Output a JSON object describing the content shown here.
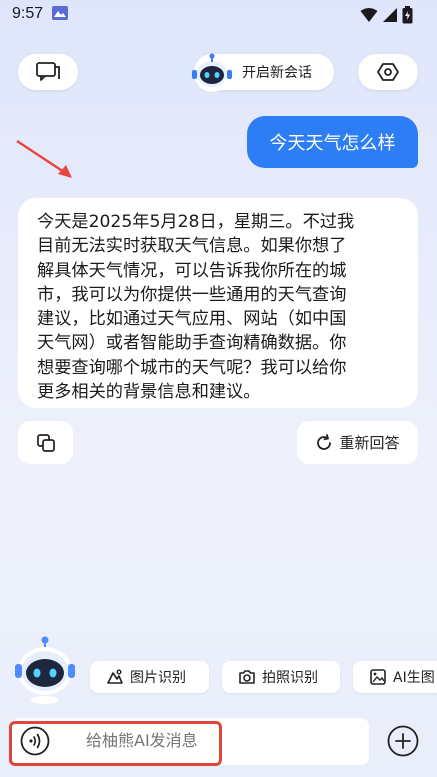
{
  "status_bar": {
    "time": "9:57"
  },
  "header": {
    "new_chat_label": "开启新会话"
  },
  "conversation": {
    "user_message": "今天天气怎么样",
    "ai_lines": [
      "今天是2025年5月28日，星期三。不过我",
      "目前无法实时获取天气信息。如果你想了",
      "解具体天气情况，可以告诉我你所在的城",
      "市，我可以为你提供一些通用的天气查询",
      "建议，比如通过天气应用、网站（如中国",
      "天气网）或者智能助手查询精确数据。你",
      "想要查询哪个城市的天气呢？我可以给你",
      "更多相关的背景信息和建议。"
    ],
    "regenerate_label": "重新回答"
  },
  "tools": {
    "items": [
      {
        "label": "图片识别",
        "icon": "image-recognition-icon"
      },
      {
        "label": "拍照识别",
        "icon": "camera-icon"
      },
      {
        "label": "AI生图",
        "icon": "image-generate-icon"
      }
    ]
  },
  "composer": {
    "placeholder": "给柚熊AI发消息"
  },
  "colors": {
    "accent": "#2d7ef5",
    "highlight": "#e0453a"
  }
}
